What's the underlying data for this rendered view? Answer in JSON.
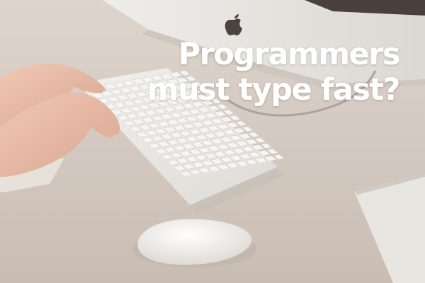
{
  "headline": {
    "line1": "Programmers",
    "line2": "must type fast?"
  },
  "icons": [
    "apple-logo-icon"
  ],
  "colors": {
    "desk": "#d7cdc5",
    "monitor_stand": "#e6e3df",
    "keyboard": "#ecebe8",
    "headline_text": "#ffffff"
  }
}
